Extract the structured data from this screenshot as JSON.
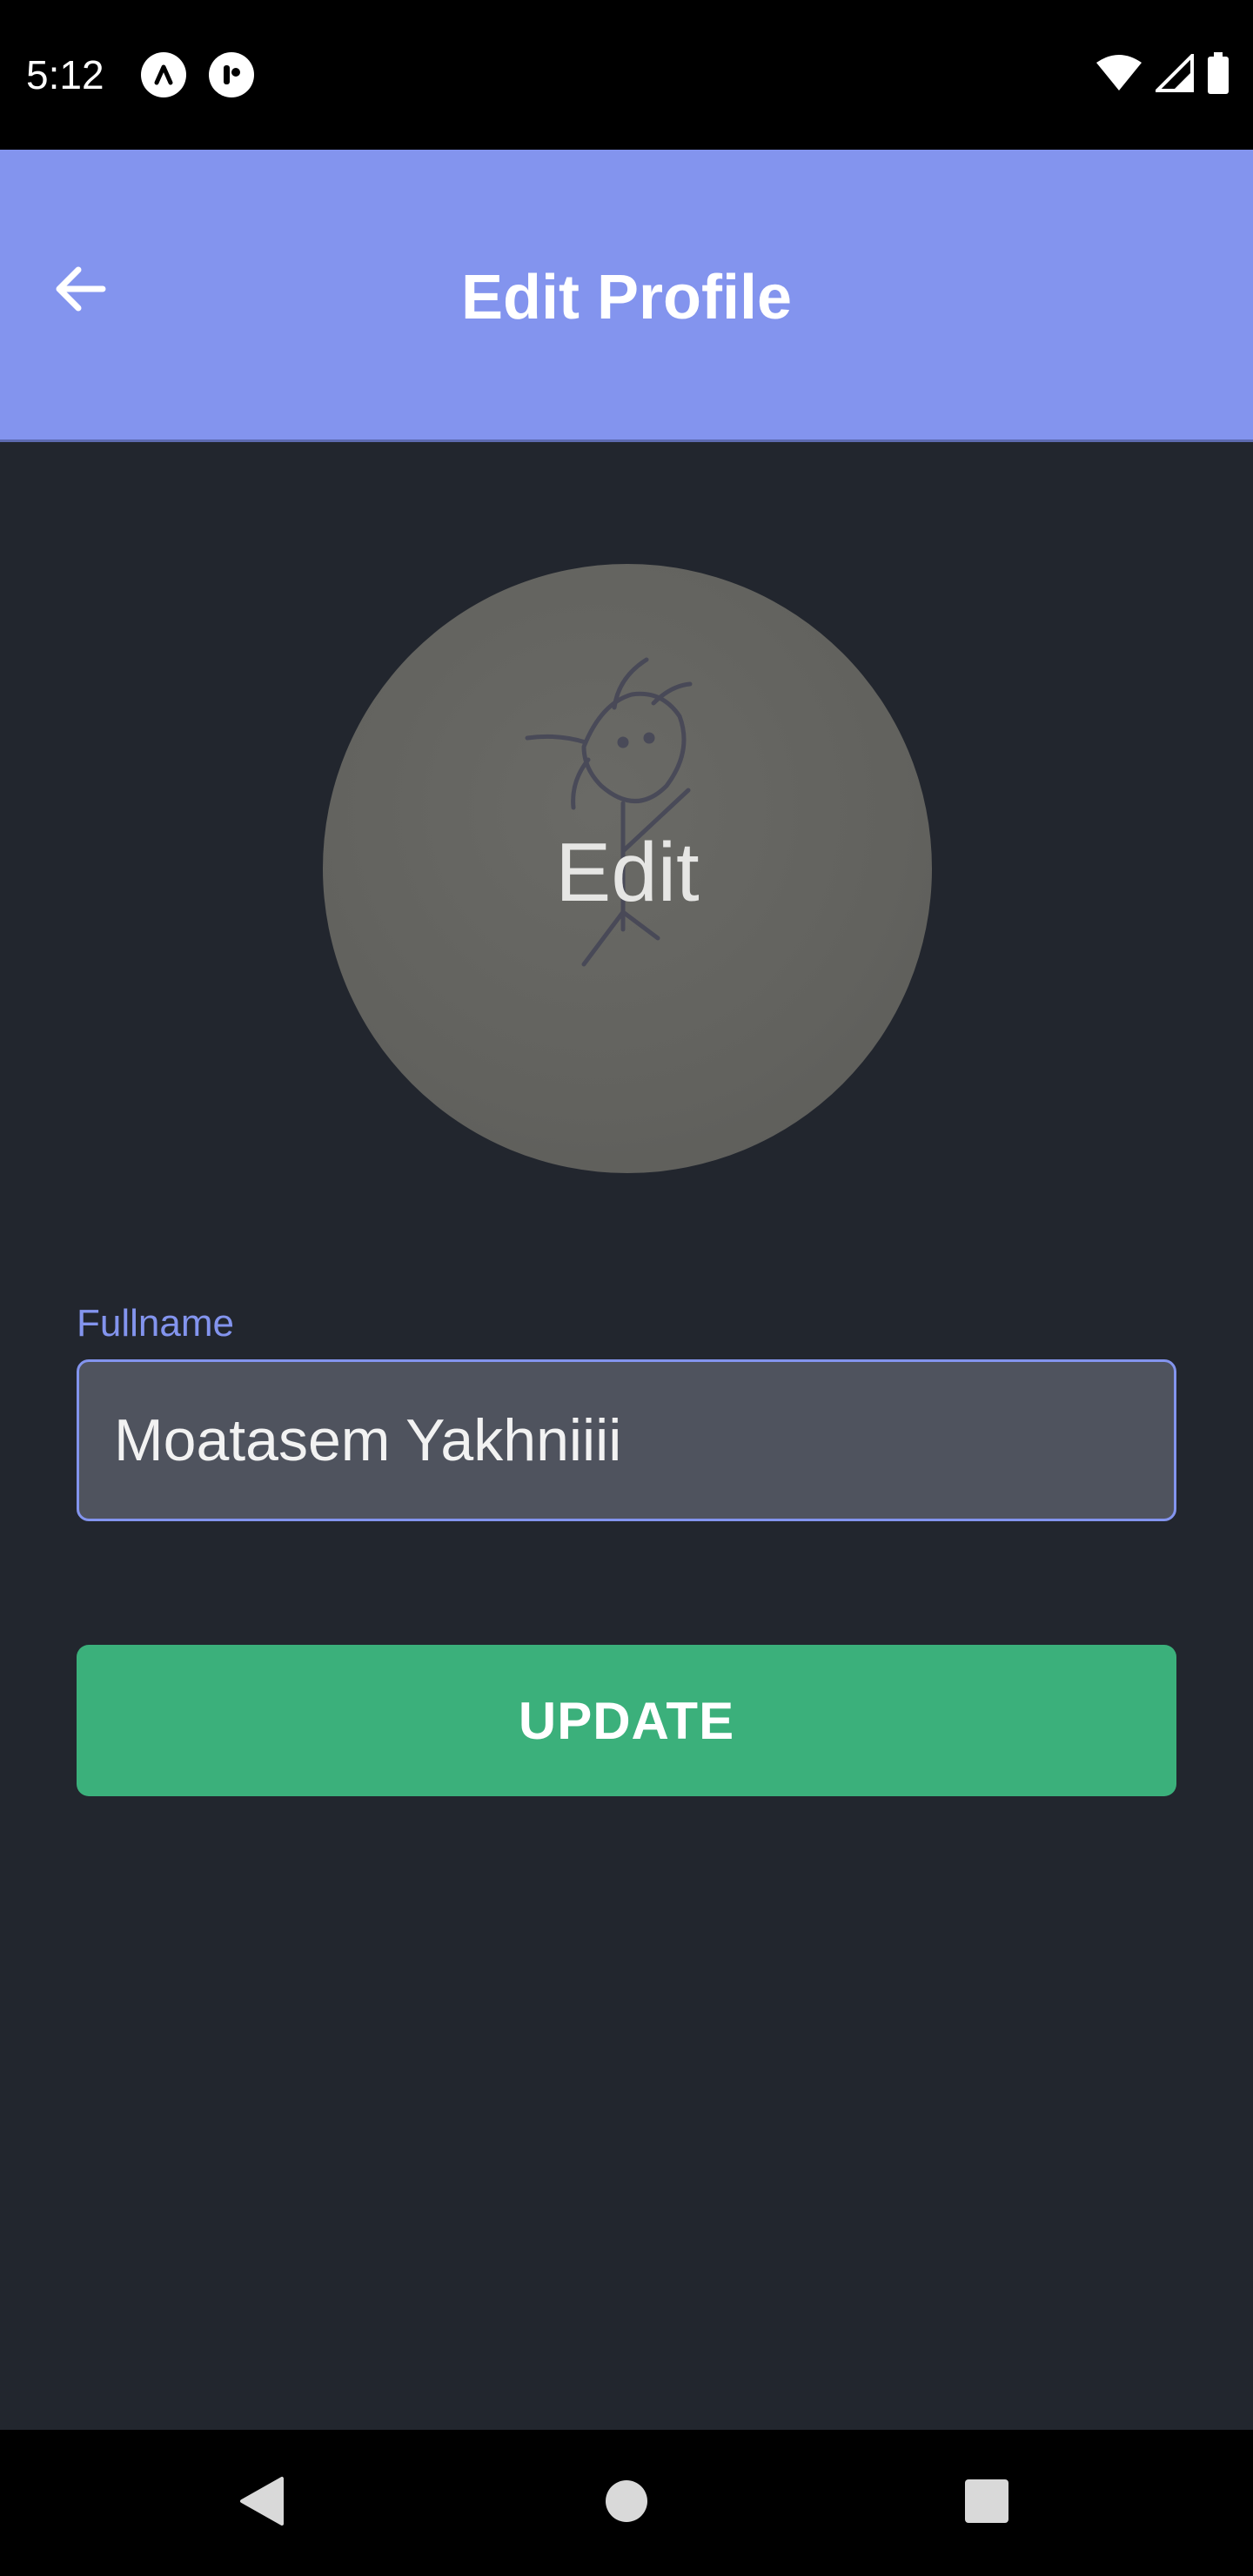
{
  "status_bar": {
    "time": "5:12",
    "icons": [
      "app-notification-icon",
      "app-notification-icon-2",
      "wifi-icon",
      "signal-icon",
      "battery-icon"
    ]
  },
  "app_bar": {
    "title": "Edit Profile",
    "back_icon": "arrow-left-icon",
    "background_color": "#8394ee"
  },
  "avatar": {
    "overlay_label": "Edit"
  },
  "form": {
    "fullname": {
      "label": "Fullname",
      "value": "Moatasem Yakhniiii"
    },
    "submit_label": "UPDATE",
    "submit_color": "#3bb07b"
  },
  "nav_bar": {
    "icons": [
      "back-triangle-icon",
      "home-circle-icon",
      "recents-square-icon"
    ]
  }
}
